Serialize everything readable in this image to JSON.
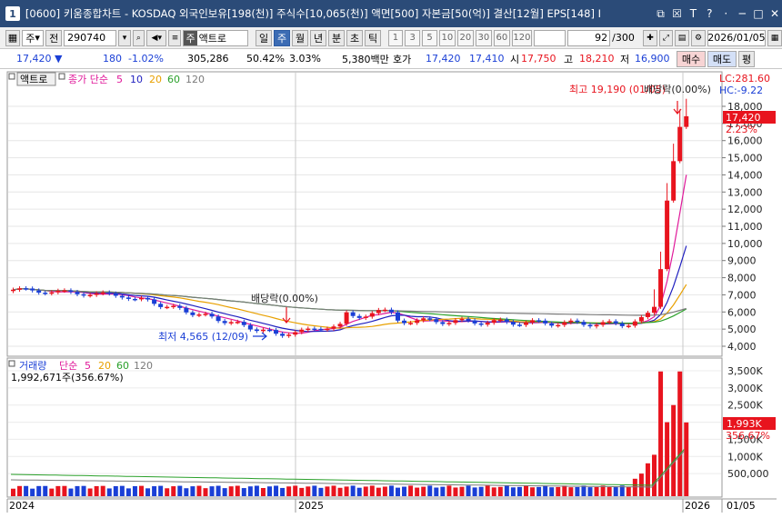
{
  "window": {
    "number": "1",
    "title": "[0600] 키움종합차트 - KOSDAQ 외국인보유[198(천)] 주식수[10,065(천)] 액면[500] 자본금[50(억)] 결산[12월] EPS[148] I",
    "buttons": [
      "⧉",
      "☒",
      "T",
      "?",
      "·",
      "─",
      "□",
      "✕"
    ]
  },
  "toolbar": {
    "period_type": "주",
    "mode": "전",
    "code": "290740",
    "stock_badge": "주",
    "stock_name": "액트로",
    "period_buttons": [
      "일",
      "주",
      "월",
      "년",
      "분",
      "초",
      "틱"
    ],
    "selected_period": "주",
    "intervals": [
      "1",
      "3",
      "5",
      "10",
      "20",
      "30",
      "60",
      "120"
    ],
    "count": "92",
    "count_max": "/300",
    "date": "2026/01/05"
  },
  "quote": {
    "price": "17,420",
    "change": "180",
    "change_pct": "-1.02%",
    "volume": "305,286",
    "vol_ratio": "50.42%",
    "turnover": "3.03%",
    "amount": "5,380백만",
    "ask_label": "호가",
    "ask": "17,420",
    "bid": "17,410",
    "open_label": "시",
    "open": "17,750",
    "high_label": "고",
    "high": "18,210",
    "low_label": "저",
    "low": "16,900",
    "buy": "매수",
    "sell": "매도",
    "eval": "평"
  },
  "price_panel": {
    "stock": "액트로",
    "legend_label": "종가 단순",
    "ma_periods": [
      "5",
      "10",
      "20",
      "60",
      "120"
    ],
    "ma_colors": [
      "#e0199a",
      "#1f1fbf",
      "#e8a000",
      "#2aa02a",
      "#7a7a7a"
    ],
    "lc": "LC:281.60",
    "hc": "HC:-9.22",
    "current_price": "17,420",
    "current_pct": "2.23%",
    "high_note": "최고 19,190 (01/05)",
    "div_note_top": "배당락(0.00%)",
    "div_note_mid": "배당락(0.00%)",
    "low_note": "최저 4,565 (12/09)",
    "y_ticks": [
      "18,000",
      "17,000",
      "16,000",
      "15,000",
      "14,000",
      "13,000",
      "12,000",
      "11,000",
      "10,000",
      "9,000",
      "8,000",
      "7,000",
      "6,000",
      "5,000",
      "4,000"
    ]
  },
  "volume_panel": {
    "legend_label": "거래량",
    "legend_type": "단순",
    "ma_periods": [
      "5",
      "20",
      "60",
      "120"
    ],
    "ma_colors": [
      "#e0199a",
      "#e8a000",
      "#2aa02a",
      "#7a7a7a"
    ],
    "current": "1,992,671주(356.67%)",
    "current_box": "1,993K",
    "current_pct": "356.67%",
    "y_ticks": [
      "3,500K",
      "3,000K",
      "2,500K",
      "2,000K",
      "1,500K",
      "1,000K",
      "500,000"
    ]
  },
  "x_axis": {
    "labels": [
      "2024",
      "2025",
      "2026",
      "01/05"
    ]
  },
  "colors": {
    "up": "#e8141e",
    "down": "#1a3fd6",
    "title_bar": "#2b4b78"
  }
}
